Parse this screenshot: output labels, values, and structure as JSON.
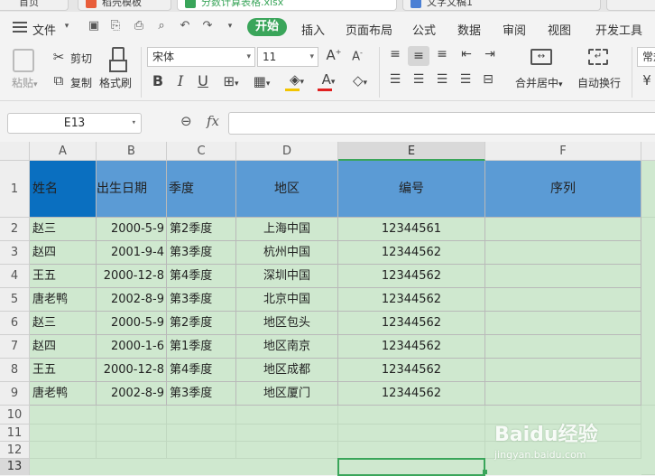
{
  "tabs": [
    {
      "label": "首页"
    },
    {
      "label": "稻壳模板"
    },
    {
      "label": "分数计算表格.xlsx"
    },
    {
      "label": "文字文稿1"
    }
  ],
  "menu": {
    "file": "文件",
    "items": [
      "开始",
      "插入",
      "页面布局",
      "公式",
      "数据",
      "审阅",
      "视图",
      "开发工具"
    ]
  },
  "ribbon": {
    "paste": "粘贴",
    "cut": "剪切",
    "copy": "复制",
    "format_painter": "格式刷",
    "font_name": "宋体",
    "font_size": "11",
    "merge_center": "合并居中",
    "wrap_text": "自动换行",
    "right_cut": "常规"
  },
  "formula_bar": {
    "name_box": "E13",
    "fx": "fx"
  },
  "sheet": {
    "columns": [
      "A",
      "B",
      "C",
      "D",
      "E",
      "F"
    ],
    "rows": [
      "1",
      "2",
      "3",
      "4",
      "5",
      "6",
      "7",
      "8",
      "9",
      "10",
      "11",
      "12",
      "13"
    ],
    "selected_cell": "E13",
    "header_row": [
      "姓名",
      "出生日期",
      "季度",
      "地区",
      "编号",
      "序列"
    ],
    "data_rows": [
      [
        "赵三",
        "2000-5-9",
        "第2季度",
        "上海中国",
        "12344561",
        ""
      ],
      [
        "赵四",
        "2001-9-4",
        "第3季度",
        "杭州中国",
        "12344562",
        ""
      ],
      [
        "王五",
        "2000-12-8",
        "第4季度",
        "深圳中国",
        "12344562",
        ""
      ],
      [
        "唐老鸭",
        "2002-8-9",
        "第3季度",
        "北京中国",
        "12344562",
        ""
      ],
      [
        "赵三",
        "2000-5-9",
        "第2季度",
        "地区包头",
        "12344562",
        ""
      ],
      [
        "赵四",
        "2000-1-6",
        "第1季度",
        "地区南京",
        "12344562",
        ""
      ],
      [
        "王五",
        "2000-12-8",
        "第4季度",
        "地区成都",
        "12344562",
        ""
      ],
      [
        "唐老鸭",
        "2002-8-9",
        "第3季度",
        "地区厦门",
        "12344562",
        ""
      ]
    ]
  },
  "watermark": {
    "brand": "Baidu经验",
    "url": "jingyan.baidu.com"
  },
  "colors": {
    "accent_green": "#3aa55a",
    "header_blue": "#5b9bd5",
    "header_dark_blue": "#0a6fc0",
    "cell_green": "#cfe8cf"
  }
}
